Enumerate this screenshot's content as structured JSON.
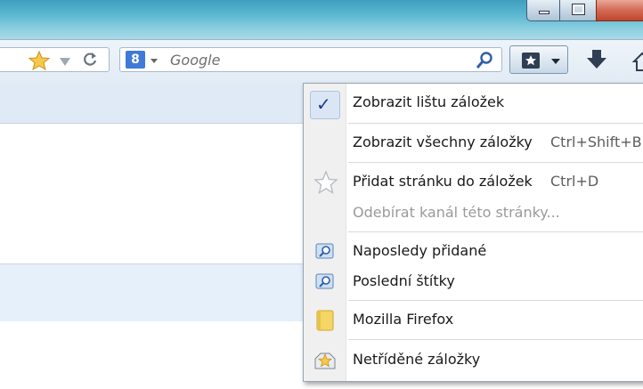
{
  "toolbar": {
    "search_placeholder": "Google",
    "search_engine_letter": "8"
  },
  "bookmarks_menu": {
    "items": [
      {
        "label": "Zobrazit lištu záložek",
        "accel": "",
        "checked": true
      },
      {
        "label": "Zobrazit všechny záložky",
        "accel": "Ctrl+Shift+B"
      },
      {
        "label": "Přidat stránku do záložek",
        "accel": "Ctrl+D"
      },
      {
        "label": "Odebírat kanál této stránky...",
        "accel": "",
        "disabled": true
      },
      {
        "label": "Naposledy přidané",
        "accel": "",
        "icon": "smart-folder-icon"
      },
      {
        "label": "Poslední štítky",
        "accel": "",
        "icon": "smart-folder-icon"
      },
      {
        "label": "Mozilla Firefox",
        "accel": "",
        "icon": "folder-icon"
      },
      {
        "label": "Netříděné záložky",
        "accel": "",
        "icon": "unsorted-bookmarks-icon"
      }
    ]
  },
  "colors": {
    "accent": "#1e3a8a",
    "toolbar_bg": "#e1ebf4",
    "menu_gutter": "#f0f0f0",
    "folder": "#f5d565"
  }
}
